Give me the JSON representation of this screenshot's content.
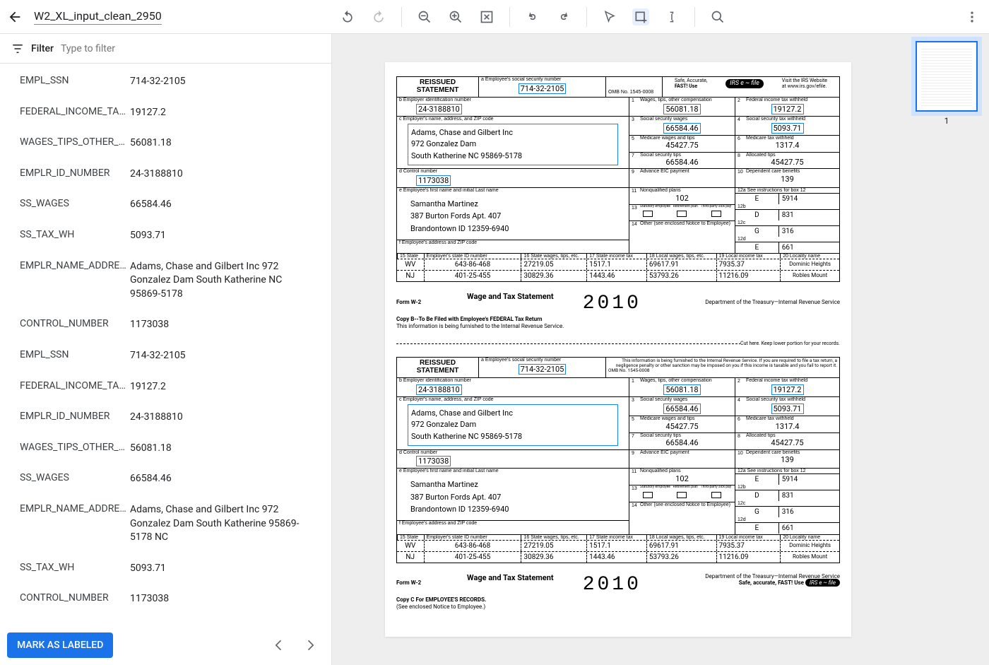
{
  "header": {
    "doc_title": "W2_XL_input_clean_2950"
  },
  "filter": {
    "label": "Filter",
    "placeholder": "Type to filter"
  },
  "fields": [
    {
      "key": "EMPL_SSN",
      "value": "714-32-2105"
    },
    {
      "key": "FEDERAL_INCOME_TAX_W...",
      "value": "19127.2"
    },
    {
      "key": "WAGES_TIPS_OTHER_CO...",
      "value": "56081.18"
    },
    {
      "key": "EMPLR_ID_NUMBER",
      "value": "24-3188810"
    },
    {
      "key": "SS_WAGES",
      "value": "66584.46"
    },
    {
      "key": "SS_TAX_WH",
      "value": "5093.71"
    },
    {
      "key": "EMPLR_NAME_ADDRESS",
      "value": "Adams, Chase and Gilbert Inc 972 Gonzalez Dam South Katherine NC 95869-5178"
    },
    {
      "key": "CONTROL_NUMBER",
      "value": "1173038"
    },
    {
      "key": "EMPL_SSN",
      "value": "714-32-2105"
    },
    {
      "key": "FEDERAL_INCOME_TAX_W...",
      "value": "19127.2"
    },
    {
      "key": "EMPLR_ID_NUMBER",
      "value": "24-3188810"
    },
    {
      "key": "WAGES_TIPS_OTHER_CO...",
      "value": "56081.18"
    },
    {
      "key": "SS_WAGES",
      "value": "66584.46"
    },
    {
      "key": "EMPLR_NAME_ADDRESS",
      "value": "Adams, Chase and Gilbert Inc 972 Gonzalez Dam South Katherine 95869-5178 NC"
    },
    {
      "key": "SS_TAX_WH",
      "value": "5093.71"
    },
    {
      "key": "CONTROL_NUMBER",
      "value": "1173038"
    }
  ],
  "footer": {
    "mark": "MARK AS LABELED"
  },
  "thumb": {
    "num": "1"
  },
  "w2": {
    "reissued": "REISSUED STATEMENT",
    "ssn_lab": "a  Employee's social security number",
    "ssn": "714-32-2105",
    "omb": "OMB No. 1545-0008",
    "efile_l1": "Safe, Accurate,",
    "efile_l2": "FAST! Use",
    "efile_logo": "IRS e ~ file",
    "efile_r1": "Visit the IRS Website",
    "efile_r2": "at www.irs.gov/efile.",
    "ein_lab": "b  Employer identification number",
    "ein": "24-3188810",
    "emp_addr_lab": "c  Employer's name, address, and ZIP code",
    "emp_line1": "Adams, Chase and Gilbert Inc",
    "emp_line2": "972 Gonzalez Dam",
    "emp_line3": "South Katherine   NC    95869-5178",
    "ctrl_lab": "d  Control number",
    "ctrl": "1173038",
    "ee_name_lab": "e  Employee's first name and initial           Last name",
    "ee_line1": "Samantha   Martinez",
    "ee_line2": "387 Burton Fords Apt. 407",
    "ee_line3": "Brandontown   ID     12359-6940",
    "ee_addr_lab": "f  Employee's address and ZIP code",
    "b1_lab": "Wages, tips, other compensation",
    "b1": "56081.18",
    "b2_lab": "Federal income tax withheld",
    "b2": "19127.2",
    "b3_lab": "Social security wages",
    "b3": "66584.46",
    "b4_lab": "Social security tax withheld",
    "b4": "5093.71",
    "b5_lab": "Medicare wages and tips",
    "b5": "45427.75",
    "b6_lab": "Medicare tax withheld",
    "b6": "1317.4",
    "b7_lab": "Social security tips",
    "b7": "66584.46",
    "b8_lab": "Allocated tips",
    "b8": "45427.75",
    "b9_lab": "Advance EIC payment",
    "b9": "",
    "b10_lab": "Dependent care benefits",
    "b10": "139",
    "b11_lab": "Nonqualified plans",
    "b11": "102",
    "b12_lab": "12a   See instructions for box 12",
    "b12a_c": "E",
    "b12a_v": "5914",
    "b12b_c": "D",
    "b12b_v": "831",
    "b12c_c": "G",
    "b12c_v": "316",
    "b12d_c": "E",
    "b12d_v": "661",
    "b13_lab": "13",
    "b13_a": "Statutory employee",
    "b13_b": "Retirement plan",
    "b13_c": "Third-party sick pay",
    "b14_lab": "Other (see enclosed Notice to Employee)",
    "st_15": "15  State",
    "st_eid": "Employer's state ID number",
    "st_16": "16  State wages, tips, etc.",
    "st_17": "17  State income tax",
    "st_18": "18  Local wages, tips, etc.",
    "st_19": "19  Local income tax",
    "st_20": "20  Locality name",
    "r1": {
      "st": "WV",
      "id": "643-86-468",
      "w": "27219.05",
      "t": "1517.1",
      "lw": "69617.91",
      "lt": "7935.37",
      "loc": "Dominic Heights"
    },
    "r2": {
      "st": "NJ",
      "id": "401-25-455",
      "w": "30829.36",
      "t": "1443.46",
      "lw": "53793.26",
      "lt": "11216.09",
      "loc": "Robles Mount"
    },
    "form": "Form  W-2",
    "wts": "Wage and Tax Statement",
    "year": "2010",
    "dept": "Department of the Treasury—Internal Revenue Service",
    "copyB": "Copy B--To Be Filed with Employee's FEDERAL Tax Return",
    "copyB2": "This information is being furnished to the Internal Revenue Service.",
    "cut": "Cut here. Keep lower portion for your records.",
    "top2": "This information is being furnished to the Internal Revenue Service. If you are required to file a tax return, a negligence penalty or other sanction may be imposed on you if this income is taxable and you fail to report it.",
    "copyC": "Copy C For EMPLOYEE'S RECORDS.",
    "copyC2": "(See enclosed Notice to Employee.)",
    "safe2": "Safe, accurate, FAST!  Use"
  }
}
